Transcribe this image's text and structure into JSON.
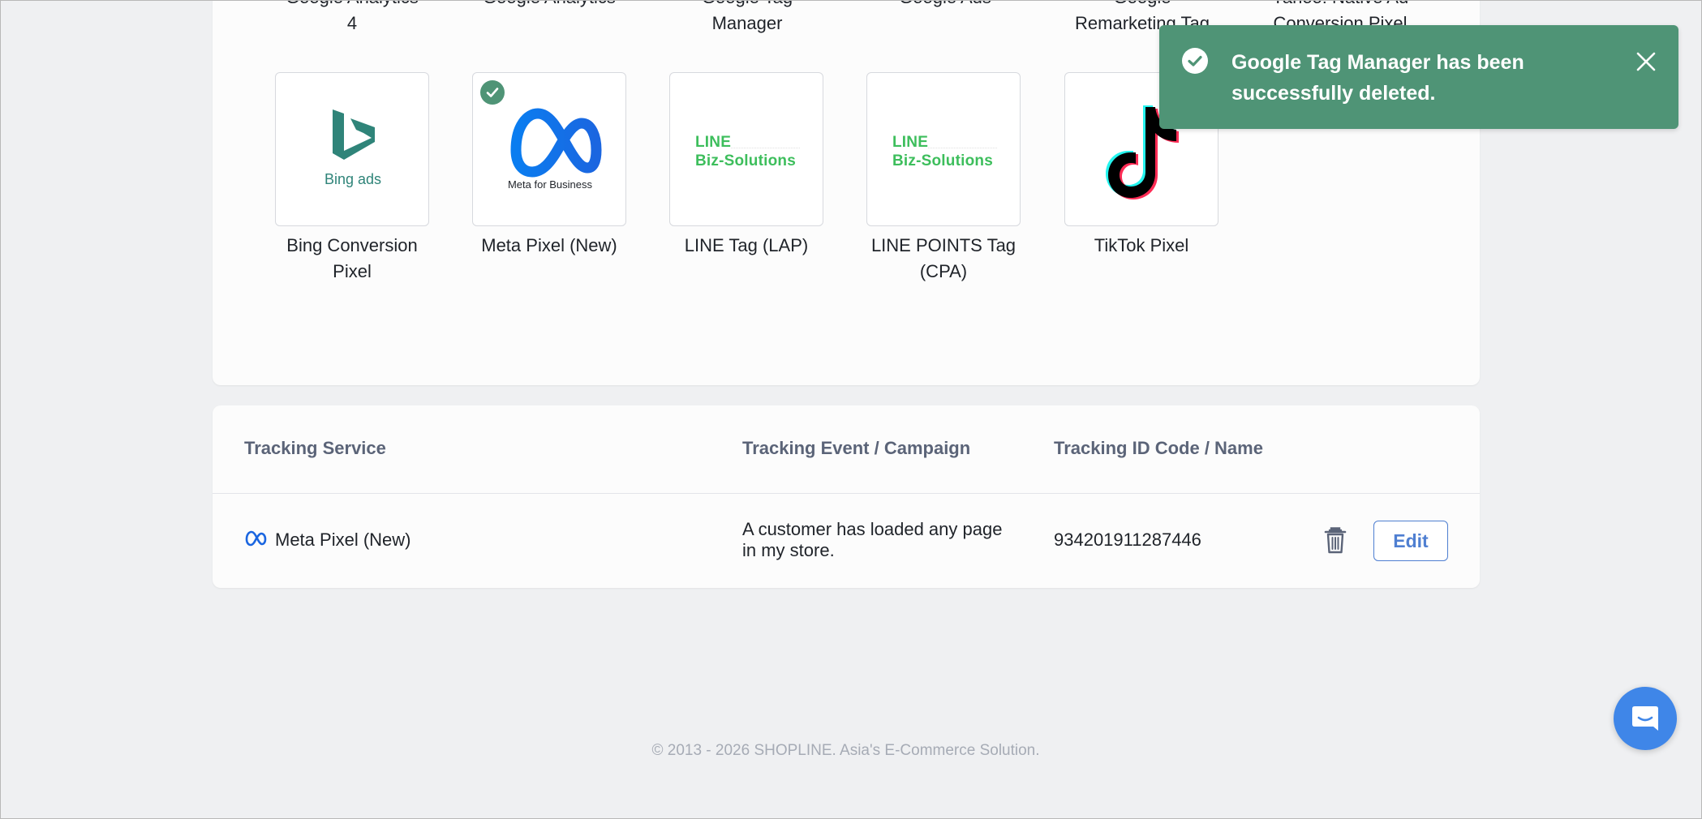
{
  "top_row_labels": [
    {
      "line1": "Google Analytics",
      "line2": "4"
    },
    {
      "line1": "Google Analytics",
      "line2": ""
    },
    {
      "line1": "Google Tag",
      "line2": "Manager"
    },
    {
      "line1": "Google Ads",
      "line2": ""
    },
    {
      "line1": "Google",
      "line2": "Remarketing Tag"
    },
    {
      "line1": "Yahoo! Native Ad",
      "line2": "Conversion Pixel"
    }
  ],
  "tiles": [
    {
      "label1": "Bing Conversion",
      "label2": "Pixel",
      "logo_text": "Bing ads",
      "selected": false
    },
    {
      "label1": "Meta Pixel (New)",
      "label2": "",
      "logo_text": "Meta for Business",
      "selected": true
    },
    {
      "label1": "LINE Tag (LAP)",
      "label2": "",
      "logo_line1": "LINE",
      "logo_line2": "Biz-Solutions",
      "selected": false
    },
    {
      "label1": "LINE POINTS Tag",
      "label2": "(CPA)",
      "logo_line1": "LINE",
      "logo_line2": "Biz-Solutions",
      "selected": false
    },
    {
      "label1": "TikTok Pixel",
      "label2": "",
      "selected": false
    }
  ],
  "table": {
    "headers": {
      "service": "Tracking Service",
      "event": "Tracking Event / Campaign",
      "id": "Tracking ID Code / Name"
    },
    "rows": [
      {
        "service": "Meta Pixel (New)",
        "event_line1": "A customer has loaded any page",
        "event_line2": "in my store.",
        "id": "934201911287446",
        "edit_label": "Edit"
      }
    ]
  },
  "toast": {
    "line1": "Google Tag Manager has been",
    "line2": "successfully deleted."
  },
  "footer": "© 2013 - 2026 SHOPLINE. Asia's E-Commerce Solution.",
  "colors": {
    "success": "#4f9476",
    "primary": "#4f7fd1",
    "chat": "#3f86e8",
    "line_green": "#3dbe5c",
    "bing_teal": "#2f8479"
  },
  "icons": {
    "toast": "check-circle-icon",
    "close": "close-icon",
    "delete": "trash-icon",
    "chat": "chat-bubble-icon"
  }
}
